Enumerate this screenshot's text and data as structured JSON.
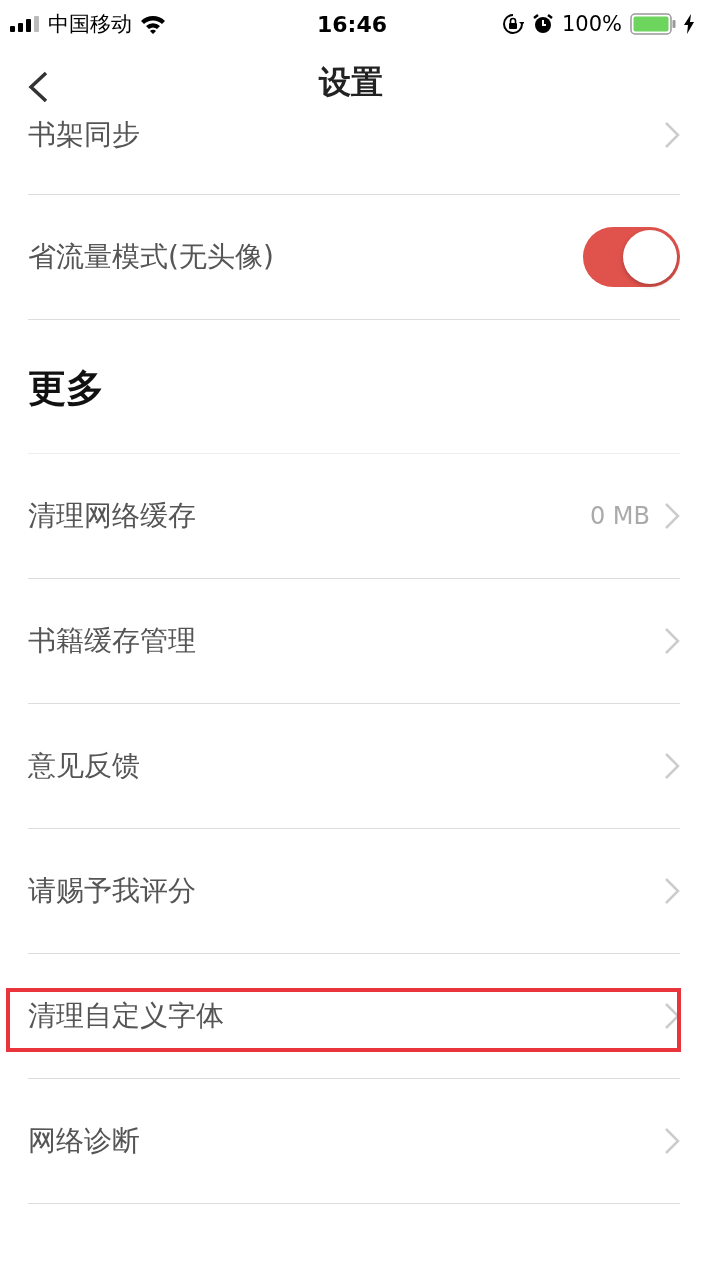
{
  "status_bar": {
    "carrier": "中国移动",
    "time": "16:46",
    "battery_percent": "100%"
  },
  "nav_bar": {
    "title": "设置"
  },
  "sections": [
    {
      "items": [
        {
          "kind": "link",
          "label": "书架同步"
        },
        {
          "kind": "toggle",
          "label": "省流量模式(无头像)",
          "on": true
        }
      ]
    },
    {
      "header": "更多",
      "items": [
        {
          "kind": "link",
          "label": "清理网络缓存",
          "value": "0 MB",
          "highlighted": false
        },
        {
          "kind": "link",
          "label": "书籍缓存管理",
          "highlighted": false
        },
        {
          "kind": "link",
          "label": "意见反馈",
          "highlighted": false
        },
        {
          "kind": "link",
          "label": "请赐予我评分",
          "highlighted": false
        },
        {
          "kind": "link",
          "label": "清理自定义字体",
          "highlighted": true
        },
        {
          "kind": "link",
          "label": "网络诊断",
          "highlighted": false
        }
      ]
    }
  ]
}
